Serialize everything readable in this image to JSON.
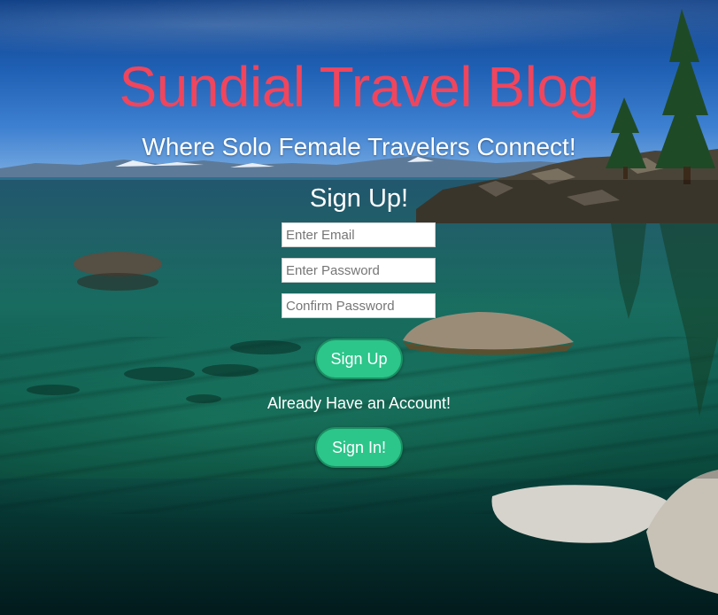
{
  "header": {
    "title": "Sundial Travel Blog",
    "tagline": "Where Solo Female Travelers Connect!"
  },
  "signup_form": {
    "heading": "Sign Up!",
    "email_placeholder": "Enter Email",
    "password_placeholder": "Enter Password",
    "confirm_placeholder": "Confirm Password",
    "submit_label": "Sign Up"
  },
  "signin": {
    "prompt": "Already Have an Account!",
    "button_label": "Sign In!"
  },
  "colors": {
    "title": "#f0455c",
    "button": "#2cc58a",
    "button_border": "#1b8f63"
  },
  "background": {
    "icon": "lake-landscape-photo"
  }
}
